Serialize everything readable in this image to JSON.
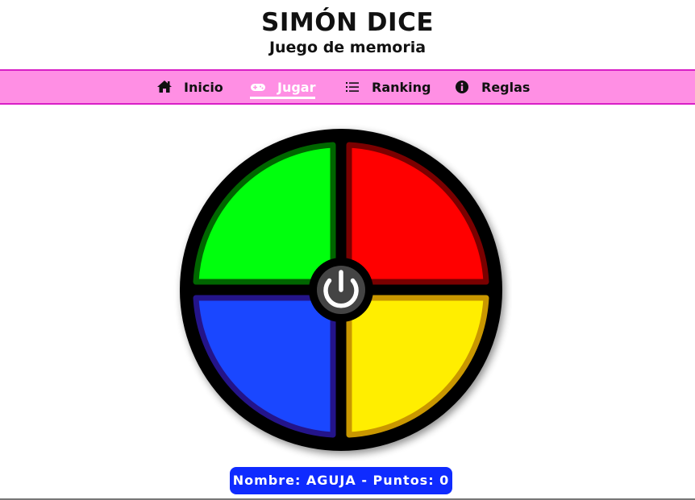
{
  "header": {
    "title": "SIMÓN DICE",
    "subtitle": "Juego de memoria"
  },
  "nav": {
    "items": [
      {
        "label": "Inicio",
        "icon": "home-icon",
        "active": false
      },
      {
        "label": "Jugar",
        "icon": "gamepad-icon",
        "active": true
      },
      {
        "label": "Ranking",
        "icon": "list-icon",
        "active": false
      },
      {
        "label": "Reglas",
        "icon": "info-icon",
        "active": false
      }
    ],
    "background": "#ff8fe4",
    "border": "#d81fc6"
  },
  "board": {
    "quadrants": [
      {
        "name": "green",
        "fill": "#00ff0d",
        "border": "#006600"
      },
      {
        "name": "red",
        "fill": "#ff0000",
        "border": "#7a0000"
      },
      {
        "name": "blue",
        "fill": "#1a47ff",
        "border": "#24148a"
      },
      {
        "name": "yellow",
        "fill": "#ffee00",
        "border": "#c99700"
      }
    ],
    "center_button": "power-icon"
  },
  "status": {
    "text": "Nombre: AGUJA - Puntos: 0",
    "background": "#0f2bff"
  }
}
